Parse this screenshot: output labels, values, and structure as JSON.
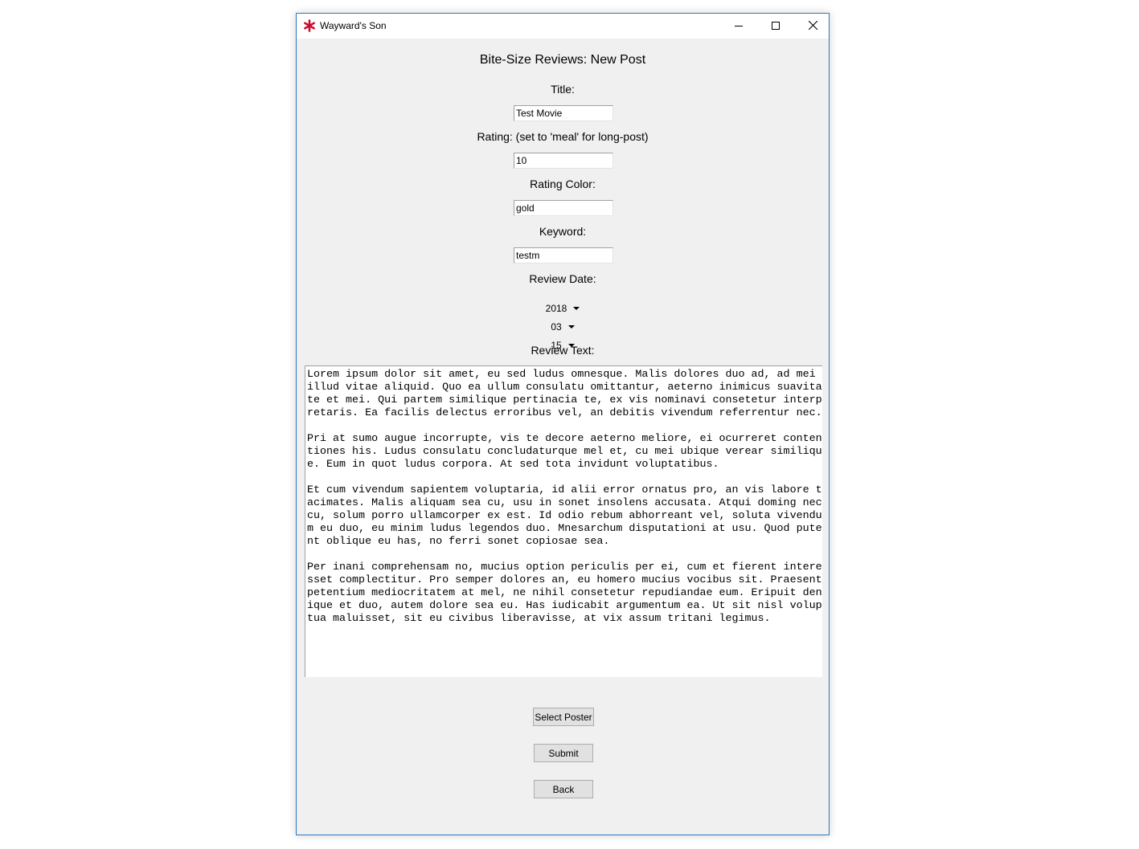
{
  "window": {
    "title": "Wayward's Son",
    "icon": "red-asterisk-icon",
    "controls": [
      "minimize-icon",
      "maximize-icon",
      "close-icon"
    ]
  },
  "form": {
    "heading": "Bite-Size Reviews: New Post",
    "title_label": "Title:",
    "title_value": "Test Movie",
    "rating_label": "Rating: (set to 'meal' for long-post)",
    "rating_value": "10",
    "rating_color_label": "Rating Color:",
    "rating_color_value": "gold",
    "keyword_label": "Keyword:",
    "keyword_value": "testm",
    "review_date_label": "Review Date:",
    "review_year": "2018",
    "review_month": "03",
    "review_day": "15",
    "review_text_label": "Review Text:",
    "review_text": "Lorem ipsum dolor sit amet, eu sed ludus omnesque. Malis dolores duo ad, ad mei illud vitae aliquid. Quo ea ullum consulatu omittantur, aeterno inimicus suavitate et mei. Qui partem similique pertinacia te, ex vis nominavi consetetur interpretaris. Ea facilis delectus erroribus vel, an debitis vivendum referrentur nec.\n\nPri at sumo augue incorrupte, vis te decore aeterno meliore, ei ocurreret contentiones his. Ludus consulatu concludaturque mel et, cu mei ubique verear similique. Eum in quot ludus corpora. At sed tota invidunt voluptatibus.\n\nEt cum vivendum sapientem voluptaria, id alii error ornatus pro, an vis labore tacimates. Malis aliquam sea cu, usu in sonet insolens accusata. Atqui doming nec cu, solum porro ullamcorper ex est. Id odio rebum abhorreant vel, soluta vivendum eu duo, eu minim ludus legendos duo. Mnesarchum disputationi at usu. Quod putent oblique eu has, no ferri sonet copiosae sea.\n\nPer inani comprehensam no, mucius option periculis per ei, cum et fierent interesset complectitur. Pro semper dolores an, eu homero mucius vocibus sit. Praesent petentium mediocritatem at mel, ne nihil consetetur repudiandae eum. Eripuit denique et duo, autem dolore sea eu. Has iudicabit argumentum ea. Ut sit nisl voluptua maluisset, sit eu civibus liberavisse, at vix assum tritani legimus."
  },
  "buttons": {
    "select_poster": "Select Poster",
    "submit": "Submit",
    "back": "Back"
  },
  "colors": {
    "window_border": "#2b79c2",
    "window_bg": "#f0f0f0",
    "icon_red": "#c8102e"
  }
}
